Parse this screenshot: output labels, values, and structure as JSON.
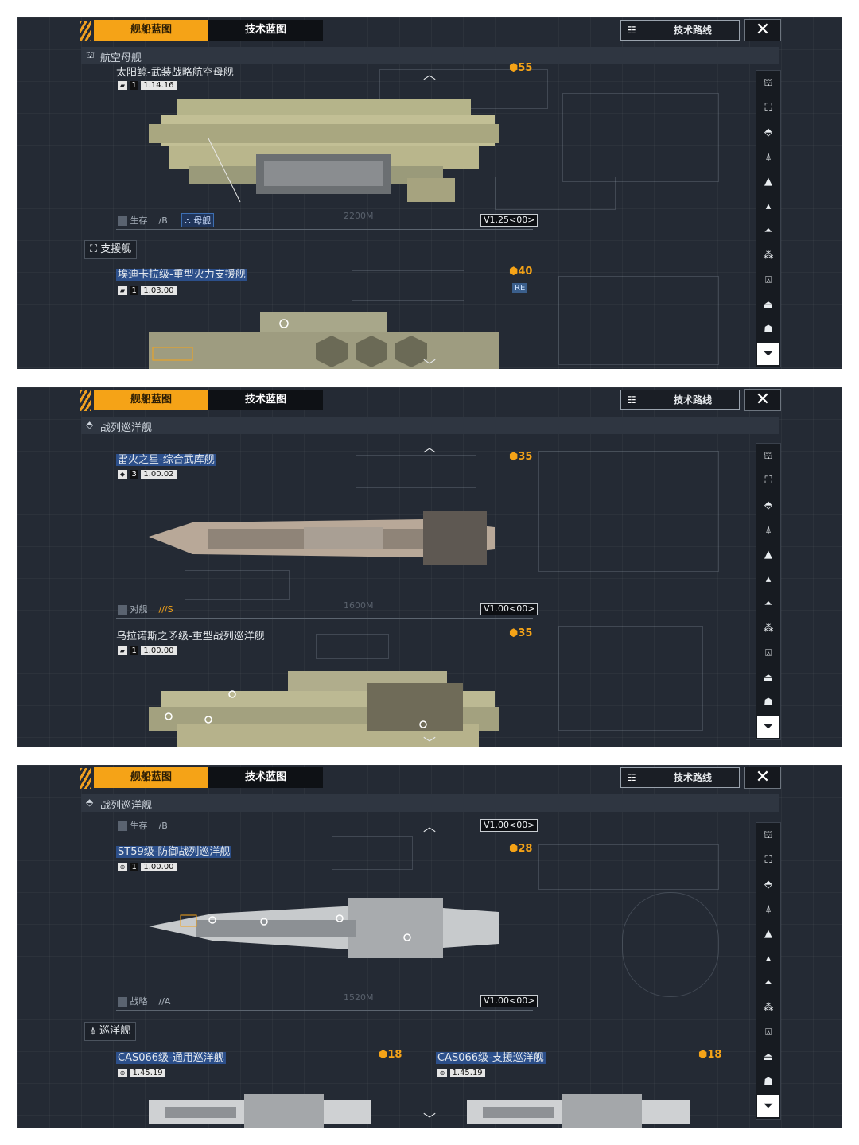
{
  "tabs": {
    "ship_blueprint": "舰船蓝图",
    "tech_blueprint": "技术蓝图"
  },
  "buttons": {
    "tech_route": "技术路线",
    "close": "✕"
  },
  "sidebar_icons": [
    "carrier-icon",
    "support-icon",
    "battlecruiser-icon",
    "cruiser-icon",
    "destroyer-icon",
    "frigate-icon",
    "corvette-icon",
    "fighter-icon",
    "auxiliary-icon",
    "station-icon",
    "misc-icon"
  ],
  "colors": {
    "accent": "#f5a317",
    "panel_bg": "#242a34",
    "highlight_blue": "#2c4f8a"
  },
  "panel1": {
    "category": "航空母舰",
    "ship1": {
      "name": "太阳鲸-武装战略航空母舰",
      "level": "1",
      "version_num": "1.14.16",
      "cost": "55",
      "role": "生存",
      "role_grade": "/B",
      "tag": "母舰",
      "distance": "2200M",
      "version": "V1.25<00>"
    },
    "section": "支援舰",
    "ship2": {
      "name": "埃迪卡拉级-重型火力支援舰",
      "level": "1",
      "version_num": "1.03.00",
      "cost": "40",
      "badge": "RE"
    }
  },
  "panel2": {
    "category": "战列巡洋舰",
    "ship1": {
      "name": "雷火之星-综合武库舰",
      "level": "3",
      "version_num": "1.00.02",
      "cost": "35",
      "role": "对舰",
      "role_grade": "///S",
      "distance": "1600M",
      "version": "V1.00<00>"
    },
    "ship2": {
      "name": "乌拉诺斯之矛级-重型战列巡洋舰",
      "level": "1",
      "version_num": "1.00.00",
      "cost": "35"
    }
  },
  "panel3": {
    "category": "战列巡洋舰",
    "top_role": "生存",
    "top_role_grade": "/B",
    "top_version": "V1.00<00>",
    "ship1": {
      "name": "ST59级-防御战列巡洋舰",
      "level": "1",
      "version_num": "1.00.00",
      "cost": "28",
      "role": "战略",
      "role_grade": "//A",
      "distance": "1520M",
      "version": "V1.00<00>"
    },
    "section": "巡洋舰",
    "ship2": {
      "name": "CAS066级-通用巡洋舰",
      "version_num": "1.45.19",
      "cost": "18"
    },
    "ship3": {
      "name": "CAS066级-支援巡洋舰",
      "version_num": "1.45.19",
      "cost": "18"
    }
  }
}
